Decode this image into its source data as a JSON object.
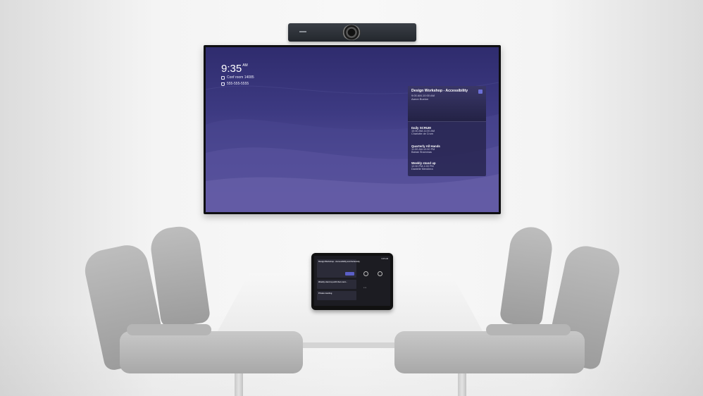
{
  "display": {
    "time": "9:35",
    "ampm": "AM",
    "room": "Conf room 14085",
    "phone": "555-555-5555",
    "meetings": [
      {
        "title": "Design Workshop - Accessibility",
        "time": "9:00 AM-10:00 AM",
        "organizer": "Aaron Buxton"
      },
      {
        "title": "Daily SCRUM",
        "time": "10:30 AM-11:00 AM",
        "organizer": "Charlotte de Crum"
      },
      {
        "title": "Quarterly All Hands",
        "time": "11:00 AM-12:00 PM",
        "organizer": "Babak Shammas"
      },
      {
        "title": "Weekly stand up",
        "time": "12:30 PM-1:00 PM",
        "organizer": "Danielle Mendiera"
      }
    ]
  },
  "console": {
    "time": "9:35 AM",
    "cards": [
      {
        "title": "Design Workshop - Accessibility and Inclusivity"
      },
      {
        "title": "Weekly stand up with then next..."
      },
      {
        "title": "Private meeting"
      }
    ]
  },
  "colors": {
    "accent": "#5b5fc7",
    "display_bg": "#3d3a82"
  },
  "icons": [
    "room-icon",
    "phone-icon",
    "teams-icon",
    "camera-icon",
    "more-icon"
  ]
}
